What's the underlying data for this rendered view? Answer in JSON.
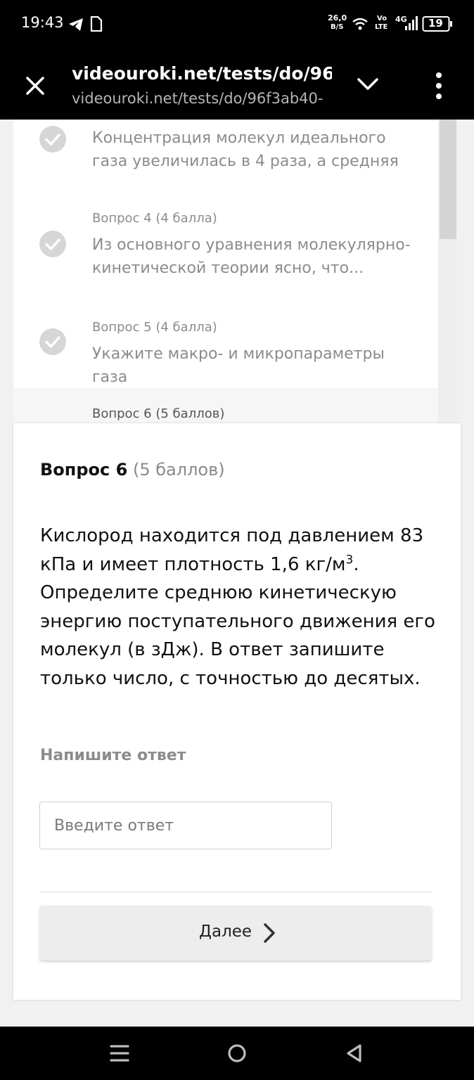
{
  "status_bar": {
    "time": "19:43",
    "net_speed_value": "26,0",
    "net_speed_unit": "B/S",
    "volte_top": "Vo",
    "volte_bottom": "LTE",
    "network": "4G",
    "battery": "19",
    "icons": [
      "telegram-icon",
      "document-icon",
      "wifi-icon",
      "signal-icon",
      "battery-icon"
    ]
  },
  "toolbar": {
    "title": "videouroki.net/tests/do/96f3ab40-",
    "url": "videouroki.net/tests/do/96f3ab40-",
    "icons": [
      "close-icon",
      "chevron-down-icon",
      "more-vert-icon"
    ]
  },
  "question_list": {
    "items": [
      {
        "label": "",
        "text": "Концентрация молекул идеального газа увеличилась в 4 раза, а средняя",
        "completed": true
      },
      {
        "label": "Вопрос 4 (4 балла)",
        "text": "Из основного уравнения молекулярно-кинетической теории ясно, что...",
        "completed": true
      },
      {
        "label": "Вопрос 5 (4 балла)",
        "text": "Укажите макро- и микропараметры газа",
        "completed": true
      },
      {
        "label": "Вопрос 6 (5 баллов)",
        "text": "",
        "completed": false
      }
    ]
  },
  "current_question": {
    "title": "Вопрос 6",
    "points": "(5 баллов)",
    "text_before_sup": "Кислород находится под давлением 83 кПа и имеет плотность 1,6 кг/м",
    "sup": "3",
    "text_after_sup": ". Определите среднюю кинетическую энергию поступательного движения его молекул (в зДж). В ответ запишите только число, с точностью до десятых.",
    "answer_label": "Напишите ответ",
    "answer_placeholder": "Введите ответ",
    "answer_value": "",
    "next_label": "Далее"
  },
  "colors": {
    "accent_check": "#d6d6d6",
    "muted_text": "#8c8c8c",
    "bar_background": "#000000"
  },
  "nav_bar": {
    "icons": [
      "menu-icon",
      "home-circle-icon",
      "back-triangle-icon"
    ]
  }
}
